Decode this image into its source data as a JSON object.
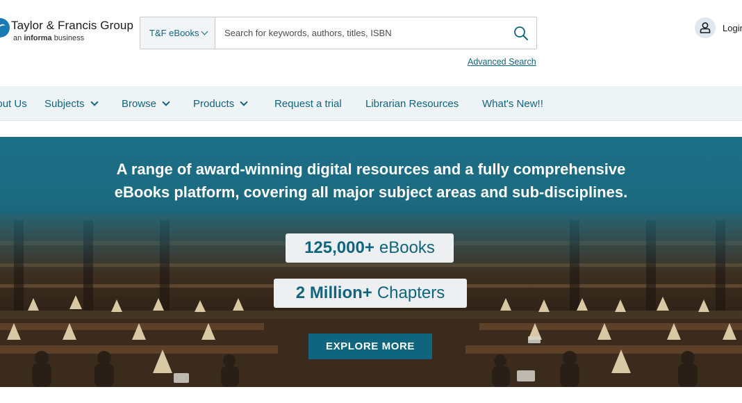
{
  "brand": {
    "title": "Taylor & Francis Group",
    "sub_prefix": "an",
    "sub_bold": "informa",
    "sub_suffix": "business"
  },
  "search": {
    "scope": "T&F eBooks",
    "placeholder": "Search for keywords, authors, titles, ISBN",
    "value": "",
    "advanced_label": "Advanced Search",
    "icon": "search-icon"
  },
  "account": {
    "login_label": "Login",
    "icon": "user-icon"
  },
  "nav": {
    "items": [
      {
        "label": "About Us",
        "has_dropdown": false
      },
      {
        "label": "Subjects",
        "has_dropdown": true
      },
      {
        "label": "Browse",
        "has_dropdown": true
      },
      {
        "label": "Products",
        "has_dropdown": true
      },
      {
        "label": "Request a trial",
        "has_dropdown": false
      },
      {
        "label": "Librarian Resources",
        "has_dropdown": false
      },
      {
        "label": "What's New!!",
        "has_dropdown": false
      }
    ]
  },
  "hero": {
    "headline_line1": "A range of award-winning digital resources and a fully comprehensive",
    "headline_line2": "eBooks platform, covering all major subject areas and sub-disciplines.",
    "stats": [
      {
        "number": "125,000+",
        "label": "eBooks"
      },
      {
        "number": "2 Million+",
        "label": "Chapters"
      }
    ],
    "cta_label": "EXPLORE MORE"
  },
  "colors": {
    "accent": "#10657e",
    "nav_bg": "#eef4f6",
    "hero_top": "#1c6f86",
    "badge_bg": "#f5f7f8",
    "cta_bg": "#10657e"
  }
}
